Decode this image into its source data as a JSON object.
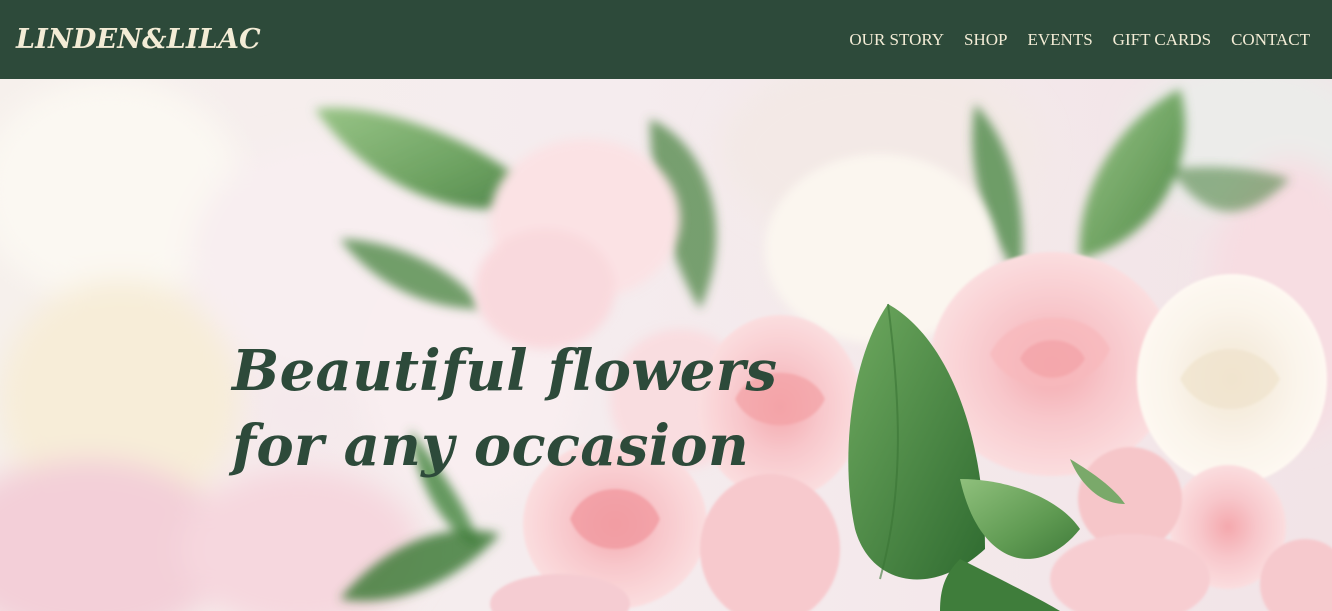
{
  "brand": {
    "name": "LINDEN&LILAC"
  },
  "nav": {
    "items": [
      {
        "label": "OUR STORY"
      },
      {
        "label": "SHOP"
      },
      {
        "label": "EVENTS"
      },
      {
        "label": "GIFT CARDS"
      },
      {
        "label": "CONTACT"
      }
    ]
  },
  "hero": {
    "headline_line1": "Beautiful flowers",
    "headline_line2": "for any occasion",
    "image_subject": "bouquet-of-pink-and-white-roses"
  },
  "colors": {
    "navbar_bg": "#2d4a3a",
    "nav_text": "#f3ecd6",
    "headline": "#2d4a3a"
  }
}
